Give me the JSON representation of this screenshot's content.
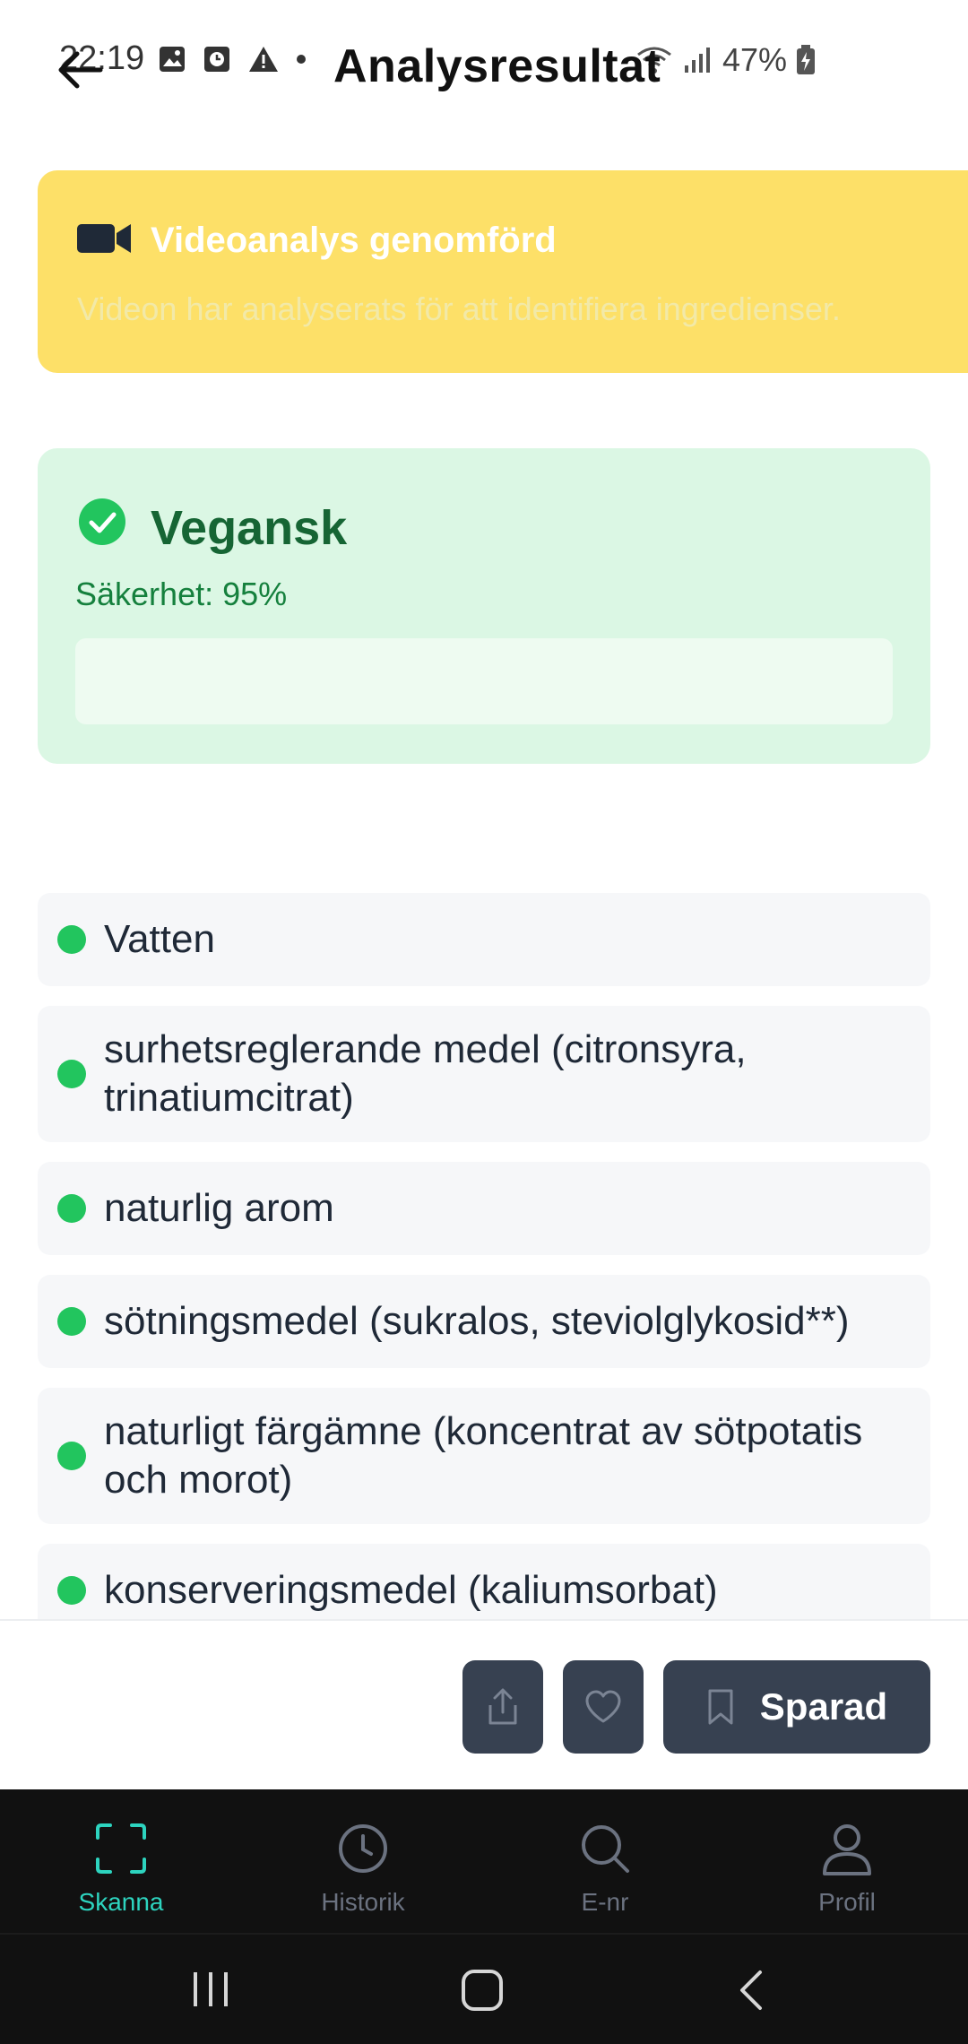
{
  "status_bar": {
    "time": "22:19",
    "battery": "47%"
  },
  "header": {
    "title": "Analysresultat"
  },
  "video_banner": {
    "title": "Videoanalys genomförd",
    "description": "Videon har analyserats för att identifiera ingredienser."
  },
  "result": {
    "label": "Vegansk",
    "confidence_text": "Säkerhet: 95%",
    "confidence_value": 0.95
  },
  "ingredients": [
    "Vatten",
    "surhetsreglerande medel (citronsyra, trinatiumcitrat)",
    "naturlig arom",
    "sötningsmedel (sukralos, steviolglykosid**)",
    "naturligt färgämne (koncentrat av sötpotatis och morot)",
    "konserveringsmedel (kaliumsorbat)"
  ],
  "actions": {
    "save_label": "Sparad"
  },
  "tabs": [
    {
      "label": "Skanna",
      "icon": "scan-icon"
    },
    {
      "label": "Historik",
      "icon": "clock-icon"
    },
    {
      "label": "E-nr",
      "icon": "search-icon"
    },
    {
      "label": "Profil",
      "icon": "user-icon"
    }
  ],
  "colors": {
    "banner": "#fde068",
    "vegan_card": "#dbf7e4",
    "vegan_text": "#166534",
    "dot": "#22c55e",
    "active_tab": "#2dd4bf",
    "button": "#374151"
  }
}
